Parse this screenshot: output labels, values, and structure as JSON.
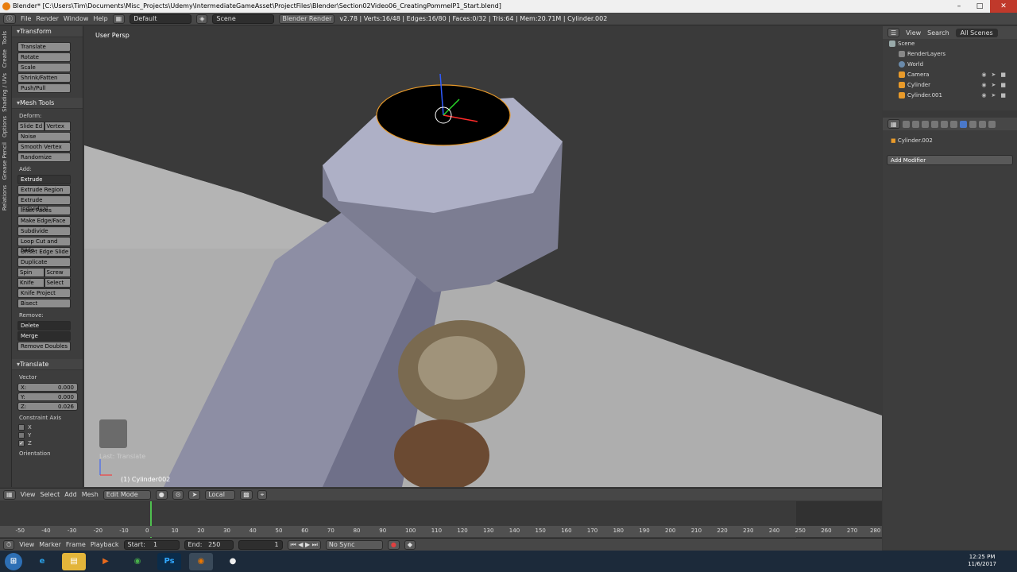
{
  "window": {
    "title": "Blender* [C:\\Users\\Tim\\Documents\\Misc_Projects\\Udemy\\IntermediateGameAsset\\ProjectFiles\\Blender\\Section02Video06_CreatingPommelP1_Start.blend]",
    "controls": [
      "minimize-icon",
      "maximize-icon",
      "close-icon"
    ]
  },
  "infobar": {
    "menus": [
      "File",
      "Render",
      "Window",
      "Help"
    ],
    "layout": "Default",
    "scene": "Scene",
    "engine": "Blender Render",
    "stats": "v2.78 | Verts:16/48 | Edges:16/80 | Faces:0/32 | Tris:64 | Mem:20.71M | Cylinder.002"
  },
  "tabs": [
    "Tools",
    "Create",
    "Shading / UVs",
    "Options",
    "Grease Pencil",
    "Relations"
  ],
  "toolshelf": {
    "transform_header": "Transform",
    "transform": [
      "Translate",
      "Rotate",
      "Scale",
      "Shrink/Fatten",
      "Push/Pull"
    ],
    "meshtools_header": "Mesh Tools",
    "deform_label": "Deform:",
    "slide_edge": "Slide Ed",
    "vertex": "Vertex",
    "deform": [
      "Noise",
      "Smooth Vertex",
      "Randomize"
    ],
    "add_label": "Add:",
    "extrude": "Extrude",
    "add": [
      "Extrude Region",
      "Extrude Individual",
      "Inset Faces",
      "Make Edge/Face",
      "Subdivide",
      "Loop Cut and Slide",
      "Offset Edge Slide",
      "Duplicate"
    ],
    "spin": "Spin",
    "screw": "Screw",
    "knife": "Knife",
    "select": "Select",
    "knife_project": "Knife Project",
    "bisect": "Bisect",
    "remove_label": "Remove:",
    "delete": "Delete",
    "merge": "Merge",
    "remove_doubles": "Remove Doubles",
    "operator_header": "Translate",
    "vector_label": "Vector",
    "x_label": "X:",
    "x_value": "0.000",
    "y_label": "Y:",
    "y_value": "0.000",
    "z_label": "Z:",
    "z_value": "0.026",
    "constraint_label": "Constraint Axis",
    "cx": "X",
    "cy": "Y",
    "cz": "Z",
    "orientation_label": "Orientation"
  },
  "viewport": {
    "view_label": "User Persp",
    "object_label": "(1) Cylinder002",
    "last_op": "Last: Translate"
  },
  "vpheader": {
    "menus": [
      "View",
      "Select",
      "Add",
      "Mesh"
    ],
    "mode": "Edit Mode",
    "orientation": "Local"
  },
  "timeline": {
    "ticks": [
      -50,
      -40,
      -30,
      -20,
      -10,
      0,
      10,
      20,
      30,
      40,
      50,
      60,
      70,
      80,
      90,
      100,
      110,
      120,
      130,
      140,
      150,
      160,
      170,
      180,
      190,
      200,
      210,
      220,
      230,
      240,
      250,
      260,
      270,
      280
    ],
    "menus": [
      "View",
      "Marker",
      "Frame",
      "Playback"
    ],
    "start_label": "Start:",
    "start": "1",
    "end_label": "End:",
    "end": "250",
    "current": "1",
    "sync": "No Sync"
  },
  "outliner": {
    "menus": [
      "View",
      "Search"
    ],
    "filter": "All Scenes",
    "items": [
      "Scene",
      "RenderLayers",
      "World",
      "Camera",
      "Cylinder",
      "Cylinder.001"
    ]
  },
  "properties": {
    "object": "Cylinder.002",
    "add_modifier": "Add Modifier"
  },
  "taskbar": {
    "apps": [
      "start-icon",
      "ie-icon",
      "explorer-icon",
      "media-icon",
      "chrome-icon",
      "photoshop-icon",
      "blender-icon",
      "obs-icon"
    ],
    "time": "12:25 PM",
    "date": "11/6/2017"
  }
}
